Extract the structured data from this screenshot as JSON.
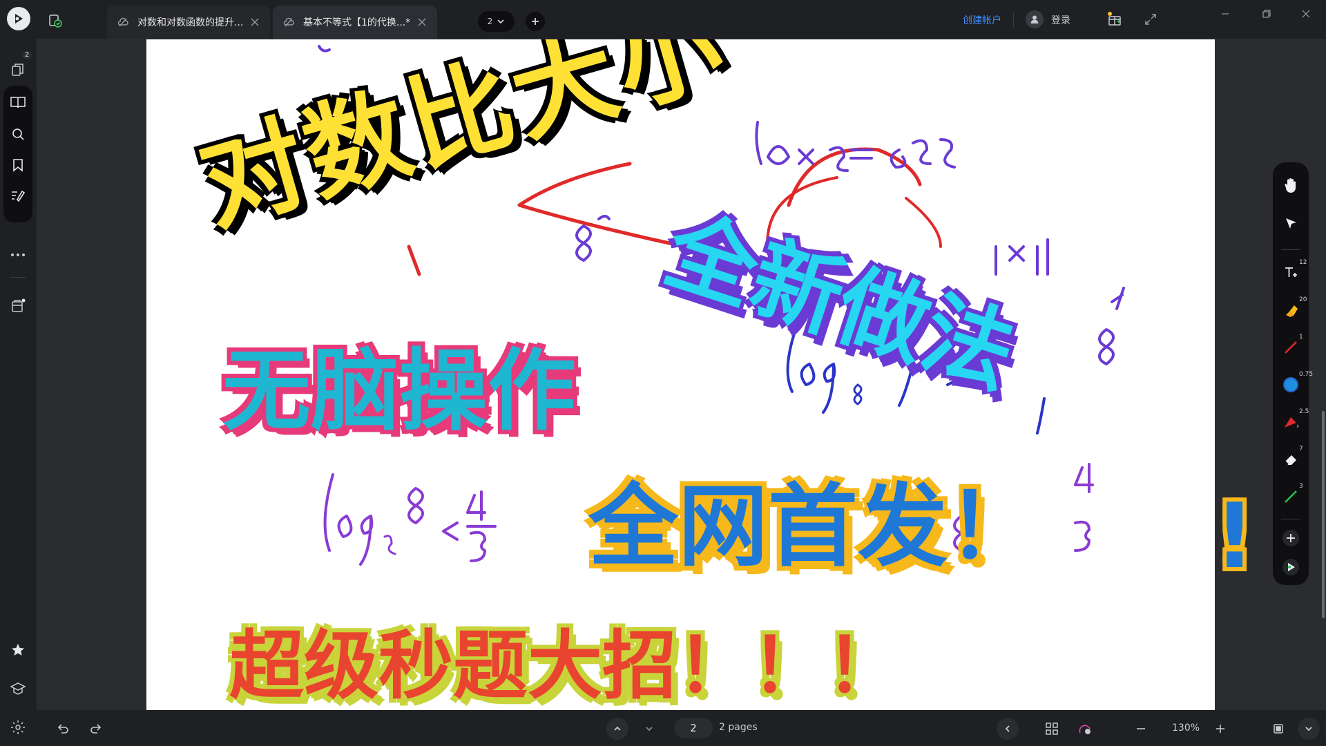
{
  "tabs": [
    {
      "label": "对数和对数函数的提升..."
    },
    {
      "label": "基本不等式【1的代换...*"
    }
  ],
  "page_badge": "2",
  "header": {
    "create_account": "创建帐户",
    "login": "登录"
  },
  "sidebar": {
    "pages_badge": "2"
  },
  "document": {
    "title_main": "对数比大小",
    "title_new": "全新做法",
    "title_brain": "无脑操作",
    "title_first": "全网首发！",
    "title_super": "超级秒题大招！！！",
    "outside_mark": "!",
    "handwriting": [
      "8",
      "5×5=625",
      "11×11",
      "8",
      "log",
      "8",
      "log₅8 < 4/3",
      "8",
      "4",
      "3",
      "4"
    ]
  },
  "right_toolbar": {
    "text_badge": "12",
    "highlighter_badge": "20",
    "pen_badge": "1",
    "color_badge": "0.75",
    "shape_badge": "2.5",
    "eraser_badge": "7",
    "green_pen_badge": "3"
  },
  "bottom": {
    "current_page": "2",
    "page_count": "2 pages",
    "zoom": "130%"
  },
  "colors": {
    "accent": "#3f8cff",
    "title_yellow": "#ffe135",
    "title_cyan": "#27d6f0",
    "title_purple": "#6a3bd4",
    "title_pink": "#e63a7a",
    "title_blue": "#1f78d6",
    "title_orange": "#f7b81b",
    "title_red": "#e8442f",
    "title_lime": "#c8d43a"
  }
}
